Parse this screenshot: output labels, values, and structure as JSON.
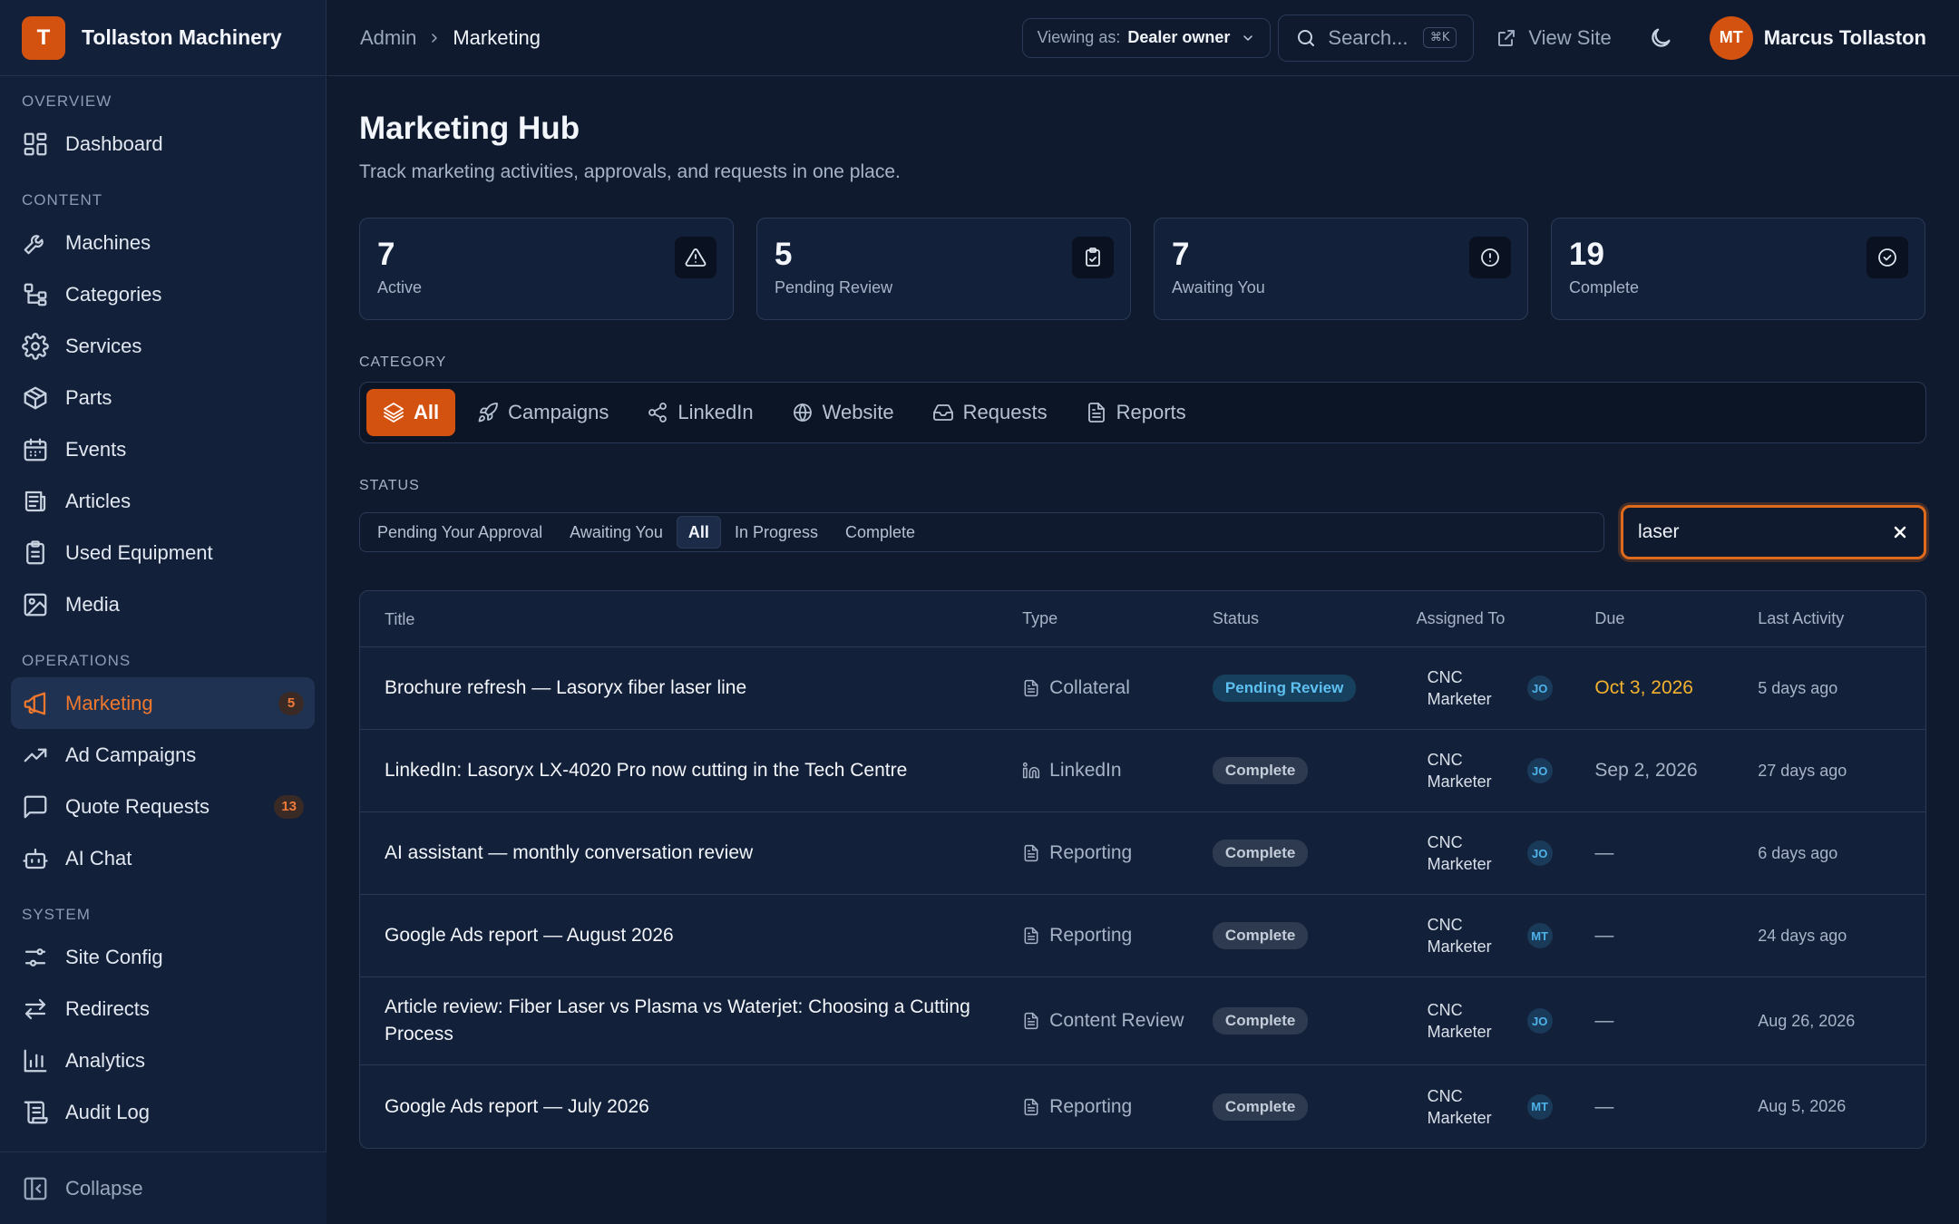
{
  "brand": {
    "initial": "T",
    "name": "Tollaston Machinery"
  },
  "sidebar": {
    "sections": [
      {
        "title": "Overview",
        "items": [
          {
            "label": "Dashboard",
            "icon": "dashboard-icon"
          }
        ]
      },
      {
        "title": "Content",
        "items": [
          {
            "label": "Machines",
            "icon": "wrench-icon"
          },
          {
            "label": "Categories",
            "icon": "tree-icon"
          },
          {
            "label": "Services",
            "icon": "gear-icon"
          },
          {
            "label": "Parts",
            "icon": "box-icon"
          },
          {
            "label": "Events",
            "icon": "calendar-icon"
          },
          {
            "label": "Articles",
            "icon": "newspaper-icon"
          },
          {
            "label": "Used Equipment",
            "icon": "clipboard-icon"
          },
          {
            "label": "Media",
            "icon": "image-icon"
          }
        ]
      },
      {
        "title": "Operations",
        "items": [
          {
            "label": "Marketing",
            "icon": "megaphone-icon",
            "badge": "5",
            "active": true
          },
          {
            "label": "Ad Campaigns",
            "icon": "trending-icon"
          },
          {
            "label": "Quote Requests",
            "icon": "message-icon",
            "badge": "13"
          },
          {
            "label": "AI Chat",
            "icon": "bot-icon"
          }
        ]
      },
      {
        "title": "System",
        "items": [
          {
            "label": "Site Config",
            "icon": "sliders-icon"
          },
          {
            "label": "Redirects",
            "icon": "arrows-icon"
          },
          {
            "label": "Analytics",
            "icon": "bar-chart-icon"
          },
          {
            "label": "Audit Log",
            "icon": "scroll-icon"
          }
        ]
      }
    ],
    "collapse_label": "Collapse"
  },
  "topbar": {
    "crumb_root": "Admin",
    "crumb_current": "Marketing",
    "viewing_label": "Viewing as:",
    "viewing_value": "Dealer owner",
    "search_placeholder": "Search...",
    "search_kbd": "⌘K",
    "view_site": "View Site",
    "user_initials": "MT",
    "user_name": "Marcus Tollaston"
  },
  "page": {
    "title": "Marketing Hub",
    "subtitle": "Track marketing activities, approvals, and requests in one place."
  },
  "stats": [
    {
      "value": "7",
      "label": "Active",
      "icon": "alert-triangle-icon"
    },
    {
      "value": "5",
      "label": "Pending Review",
      "icon": "clipboard-check-icon"
    },
    {
      "value": "7",
      "label": "Awaiting You",
      "icon": "alert-circle-icon"
    },
    {
      "value": "19",
      "label": "Complete",
      "icon": "check-circle-icon"
    }
  ],
  "category": {
    "label": "Category",
    "tabs": [
      {
        "label": "All",
        "icon": "layers-icon",
        "active": true
      },
      {
        "label": "Campaigns",
        "icon": "rocket-icon"
      },
      {
        "label": "LinkedIn",
        "icon": "share-icon"
      },
      {
        "label": "Website",
        "icon": "globe-icon"
      },
      {
        "label": "Requests",
        "icon": "inbox-icon"
      },
      {
        "label": "Reports",
        "icon": "file-icon"
      }
    ]
  },
  "status": {
    "label": "Status",
    "tabs": [
      {
        "label": "Pending Your Approval"
      },
      {
        "label": "Awaiting You"
      },
      {
        "label": "All",
        "active": true
      },
      {
        "label": "In Progress"
      },
      {
        "label": "Complete"
      }
    ],
    "filter_value": "laser"
  },
  "table": {
    "columns": [
      "Title",
      "Type",
      "Status",
      "Assigned To",
      "Due",
      "Last Activity"
    ],
    "rows": [
      {
        "title": "Brochure refresh — Lasoryx fiber laser line",
        "type": "Collateral",
        "type_icon": "file-icon",
        "status": "Pending Review",
        "status_kind": "review",
        "assignee": "CNC Marketer",
        "initials": "JO",
        "due": "Oct 3, 2026",
        "due_soon": true,
        "last": "5 days ago"
      },
      {
        "title": "LinkedIn: Lasoryx LX-4020 Pro now cutting in the Tech Centre",
        "type": "LinkedIn",
        "type_icon": "linkedin-icon",
        "status": "Complete",
        "status_kind": "complete",
        "assignee": "CNC Marketer",
        "initials": "JO",
        "due": "Sep 2, 2026",
        "last": "27 days ago"
      },
      {
        "title": "AI assistant — monthly conversation review",
        "type": "Reporting",
        "type_icon": "file-icon",
        "status": "Complete",
        "status_kind": "complete",
        "assignee": "CNC Marketer",
        "initials": "JO",
        "due": "—",
        "last": "6 days ago"
      },
      {
        "title": "Google Ads report — August 2026",
        "type": "Reporting",
        "type_icon": "file-icon",
        "status": "Complete",
        "status_kind": "complete",
        "assignee": "CNC Marketer",
        "initials": "MT",
        "due": "—",
        "last": "24 days ago"
      },
      {
        "title": "Article review: Fiber Laser vs Plasma vs Waterjet: Choosing a Cutting Process",
        "type": "Content Review",
        "type_icon": "file-icon",
        "status": "Complete",
        "status_kind": "complete",
        "assignee": "CNC Marketer",
        "initials": "JO",
        "due": "—",
        "last": "Aug 26, 2026"
      },
      {
        "title": "Google Ads report — July 2026",
        "type": "Reporting",
        "type_icon": "file-icon",
        "status": "Complete",
        "status_kind": "complete",
        "assignee": "CNC Marketer",
        "initials": "MT",
        "due": "—",
        "last": "Aug 5, 2026"
      }
    ]
  },
  "colors": {
    "accent": "#d4520f",
    "background": "#0f1a2e",
    "sidebar": "#132039",
    "due_soon": "#f2b22e"
  }
}
